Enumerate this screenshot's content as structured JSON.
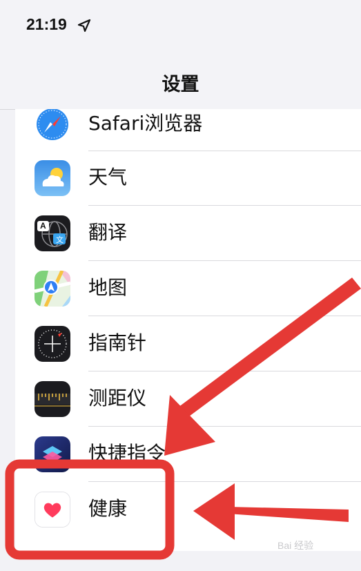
{
  "status_bar": {
    "time": "21:19"
  },
  "nav": {
    "title": "设置"
  },
  "items": [
    {
      "label": "Safari浏览器",
      "icon": "safari-compass-icon"
    },
    {
      "label": "天气",
      "icon": "weather-cloud-icon"
    },
    {
      "label": "翻译",
      "icon": "translate-icon",
      "icon_text_a": "A",
      "icon_text_b": "文"
    },
    {
      "label": "地图",
      "icon": "maps-icon"
    },
    {
      "label": "指南针",
      "icon": "compass-icon"
    },
    {
      "label": "测距仪",
      "icon": "ruler-icon"
    },
    {
      "label": "快捷指令",
      "icon": "shortcuts-icon"
    },
    {
      "label": "健康",
      "icon": "health-heart-icon"
    }
  ],
  "annotation": {
    "color": "#e53935"
  },
  "watermark": "Bai 经验"
}
